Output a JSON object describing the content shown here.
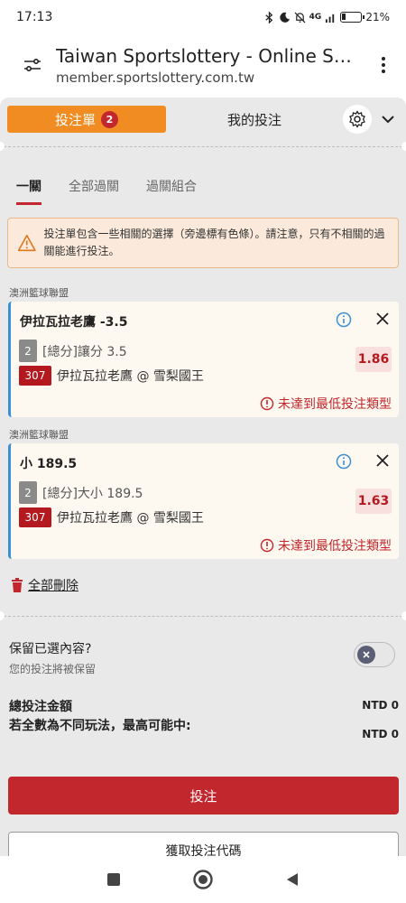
{
  "status_bar": {
    "time": "17:13",
    "network": "4G",
    "battery": "21%"
  },
  "browser": {
    "title": "Taiwan Sportslottery - Online Spor...",
    "host": "member.sportslottery.com.tw"
  },
  "header": {
    "bet_slip_label": "投注單",
    "bet_slip_count": "2",
    "my_bets_label": "我的投注"
  },
  "subtabs": [
    "一關",
    "全部過關",
    "過關組合"
  ],
  "warning": {
    "text": "投注單包含一些相關的選擇（旁邊標有色條）。請注意，只有不相關的過關能進行投注。"
  },
  "selections": [
    {
      "league": "澳洲籃球聯盟",
      "title": "伊拉瓦拉老鷹 -3.5",
      "market_num": "2",
      "market": "[總分]讓分 3.5",
      "match_code": "307",
      "match": "伊拉瓦拉老鷹 @ 雪梨國王",
      "odds": "1.86",
      "error": "未達到最低投注類型"
    },
    {
      "league": "澳洲籃球聯盟",
      "title": "小 189.5",
      "market_num": "2",
      "market": "[總分]大小 189.5",
      "match_code": "307",
      "match": "伊拉瓦拉老鷹 @ 雪梨國王",
      "odds": "1.63",
      "error": "未達到最低投注類型"
    }
  ],
  "delete_all_label": "全部刪除",
  "keep": {
    "title": "保留已選內容?",
    "subtitle": "您的投注將被保留",
    "enabled": false
  },
  "totals": {
    "stake_label": "總投注金額",
    "stake_value": "NTD 0",
    "max_win_label": "若全數為不同玩法，最高可能中:",
    "max_win_value": "NTD 0"
  },
  "submit_label": "投注",
  "get_code_label": "獲取投注代碼",
  "colors": {
    "accent_orange": "#f08c22",
    "brand_red": "#c1272d",
    "related_bar": "#3b8fd6"
  }
}
